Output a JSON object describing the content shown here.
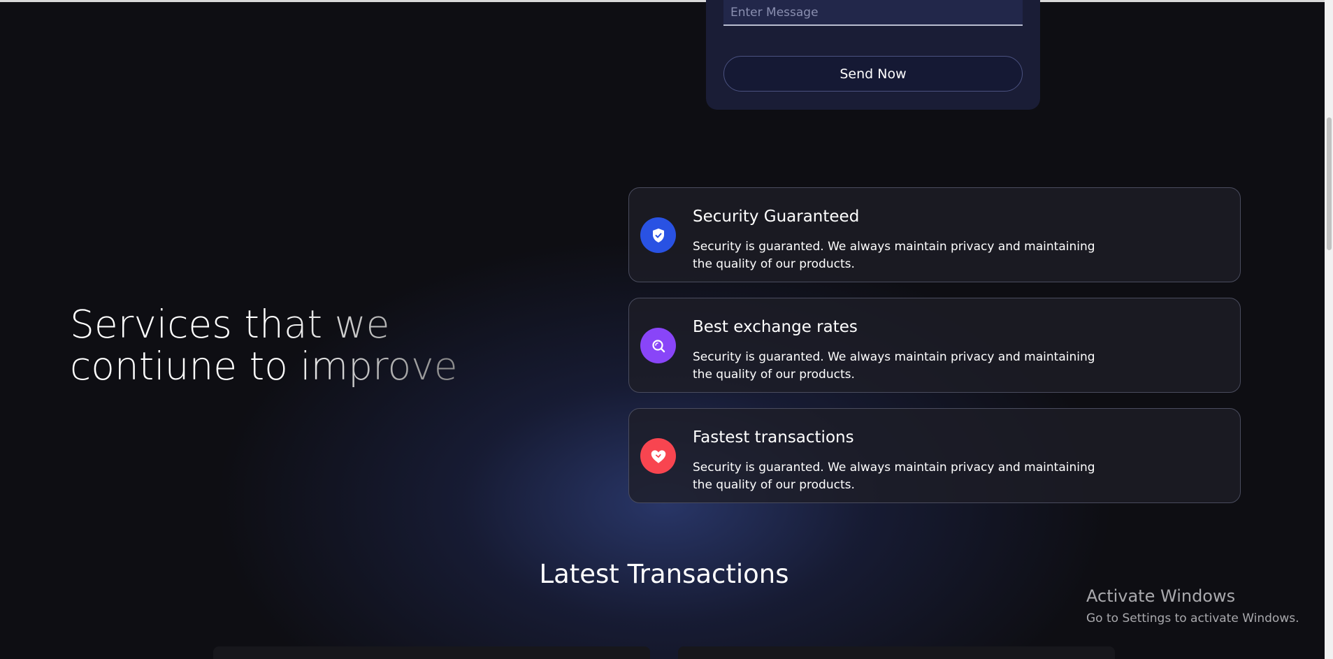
{
  "contact_form": {
    "message_placeholder": "Enter Message",
    "send_label": "Send Now"
  },
  "services": {
    "heading": "Services that we contiune to improve",
    "items": [
      {
        "title": "Security Guaranteed",
        "description": "Security is guaranted. We always maintain privacy and maintaining the quality of our products.",
        "icon": "shield-check-icon",
        "color": "#2952e3"
      },
      {
        "title": "Best exchange rates",
        "description": "Security is guaranted. We always maintain privacy and maintaining the quality of our products.",
        "icon": "search-icon",
        "color": "#8945f8"
      },
      {
        "title": "Fastest transactions",
        "description": "Security is guaranted. We always maintain privacy and maintaining the quality of our products.",
        "icon": "heart-icon",
        "color": "#f84550"
      }
    ]
  },
  "transactions": {
    "heading": "Latest Transactions"
  },
  "windows_watermark": {
    "title": "Activate Windows",
    "subtitle": "Go to Settings to activate Windows."
  }
}
